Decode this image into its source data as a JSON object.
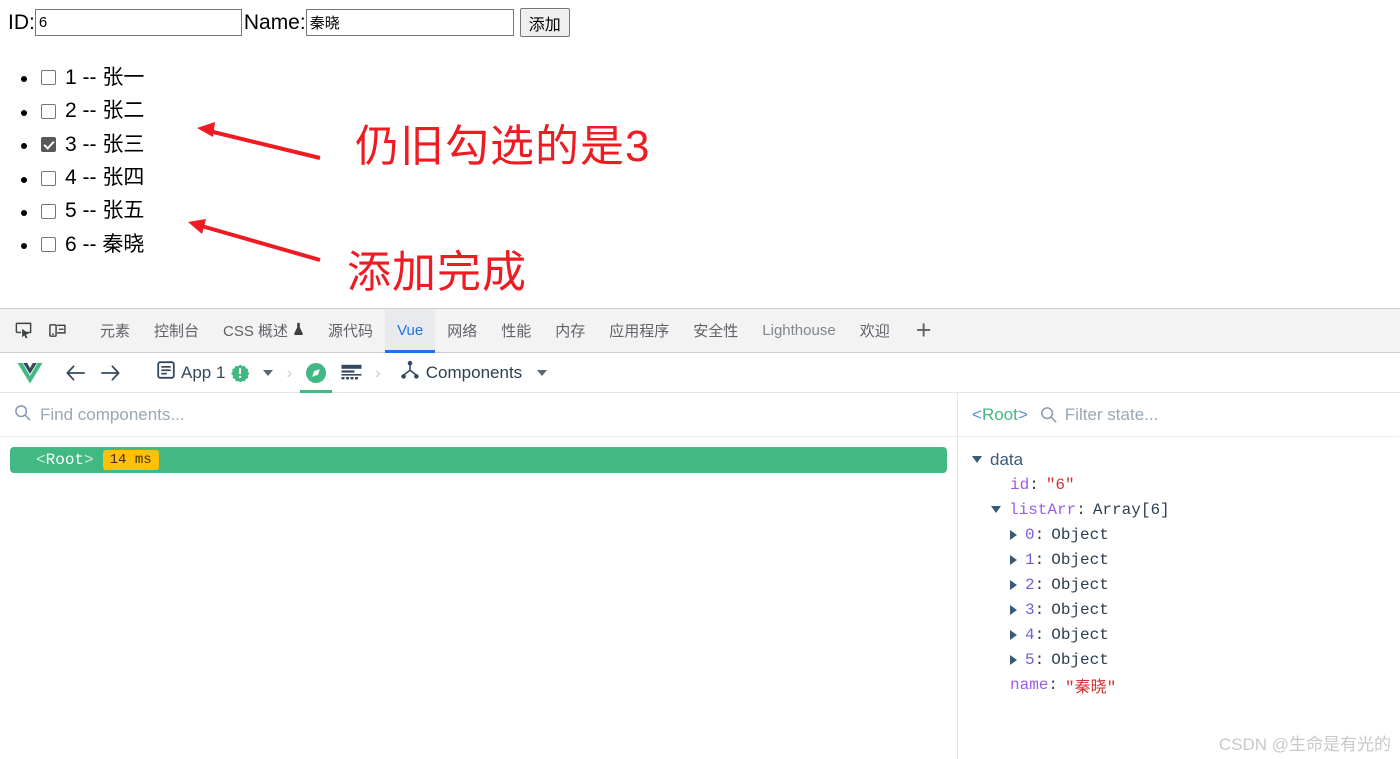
{
  "app": {
    "id_label": "ID:",
    "id_value": "6",
    "name_label": "Name:",
    "name_value": "秦晓",
    "add_button": "添加",
    "list": [
      {
        "id": "1",
        "sep": "--",
        "name": "张一",
        "checked": false
      },
      {
        "id": "2",
        "sep": "--",
        "name": "张二",
        "checked": false
      },
      {
        "id": "3",
        "sep": "--",
        "name": "张三",
        "checked": true
      },
      {
        "id": "4",
        "sep": "--",
        "name": "张四",
        "checked": false
      },
      {
        "id": "5",
        "sep": "--",
        "name": "张五",
        "checked": false
      },
      {
        "id": "6",
        "sep": "--",
        "name": "秦晓",
        "checked": false
      }
    ],
    "annotations": [
      {
        "text": "仍旧勾选的是3",
        "color": "#ee1c22"
      },
      {
        "text": "添加完成",
        "color": "#ee1c22"
      }
    ]
  },
  "devtools": {
    "tabs": [
      {
        "label": "元素",
        "active": false,
        "dim": false
      },
      {
        "label": "控制台",
        "active": false,
        "dim": false
      },
      {
        "label": "CSS 概述",
        "active": false,
        "dim": false,
        "icon": "flask-icon"
      },
      {
        "label": "源代码",
        "active": false,
        "dim": false
      },
      {
        "label": "Vue",
        "active": true,
        "dim": false
      },
      {
        "label": "网络",
        "active": false,
        "dim": false
      },
      {
        "label": "性能",
        "active": false,
        "dim": false
      },
      {
        "label": "内存",
        "active": false,
        "dim": false
      },
      {
        "label": "应用程序",
        "active": false,
        "dim": false
      },
      {
        "label": "安全性",
        "active": false,
        "dim": false
      },
      {
        "label": "Lighthouse",
        "active": false,
        "dim": true
      },
      {
        "label": "欢迎",
        "active": false,
        "dim": false
      }
    ],
    "add_tab": "+",
    "vue_toolbar": {
      "app_label": "App 1",
      "badge": "!",
      "separator": "›",
      "view_label": "Components"
    },
    "components_pane": {
      "search_placeholder": "Find components...",
      "root_brackets_open": "<",
      "root_name": "Root",
      "root_brackets_close": ">",
      "render_time": "14 ms"
    },
    "state_pane": {
      "header_open": "<",
      "header_name": "Root",
      "header_close": ">",
      "filter_placeholder": "Filter state...",
      "group": "data",
      "entries": [
        {
          "indent": 1,
          "arrow": "none",
          "key": "id",
          "colon": ":",
          "value": "\"6\"",
          "value_kind": "string"
        },
        {
          "indent": 0,
          "arrow": "down",
          "key": "listArr",
          "colon": ":",
          "value": "Array[6]",
          "value_kind": "plain"
        },
        {
          "indent": 1,
          "arrow": "right",
          "key": "0",
          "colon": ":",
          "value": "Object",
          "value_kind": "plain"
        },
        {
          "indent": 1,
          "arrow": "right",
          "key": "1",
          "colon": ":",
          "value": "Object",
          "value_kind": "plain"
        },
        {
          "indent": 1,
          "arrow": "right",
          "key": "2",
          "colon": ":",
          "value": "Object",
          "value_kind": "plain"
        },
        {
          "indent": 1,
          "arrow": "right",
          "key": "3",
          "colon": ":",
          "value": "Object",
          "value_kind": "plain"
        },
        {
          "indent": 1,
          "arrow": "right",
          "key": "4",
          "colon": ":",
          "value": "Object",
          "value_kind": "plain"
        },
        {
          "indent": 1,
          "arrow": "right",
          "key": "5",
          "colon": ":",
          "value": "Object",
          "value_kind": "plain"
        },
        {
          "indent": 1,
          "arrow": "none",
          "key": "name",
          "colon": ":",
          "value": "\"秦晓\"",
          "value_kind": "string"
        }
      ]
    }
  },
  "watermark": "CSDN @生命是有光的"
}
